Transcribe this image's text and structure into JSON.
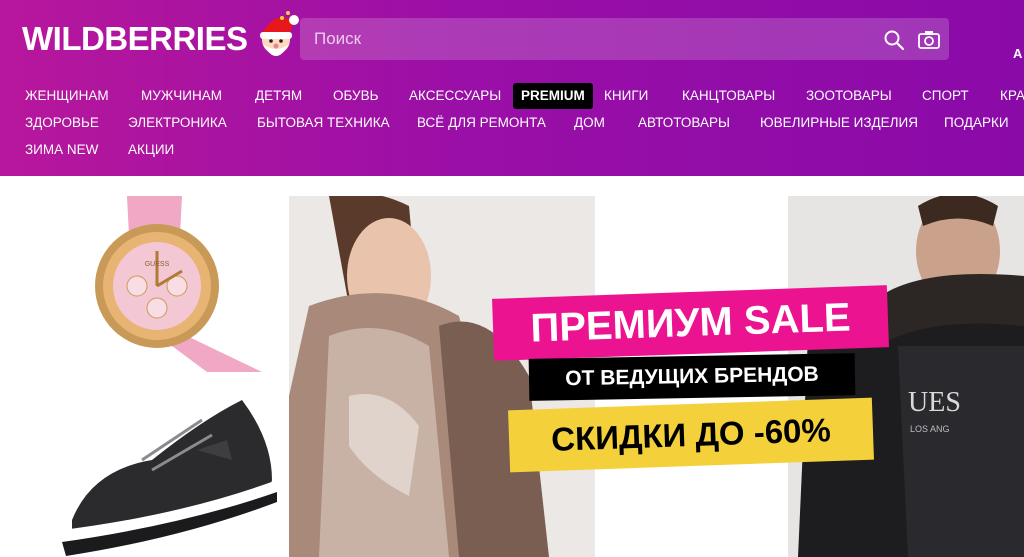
{
  "header": {
    "logo_text": "WILDBERRIES",
    "search": {
      "placeholder": "Поиск"
    },
    "right_edge_text": "А",
    "brand_color": "#a312a6"
  },
  "nav": {
    "row1": [
      {
        "label": "ЖЕНЩИНАМ"
      },
      {
        "label": "МУЖЧИНАМ"
      },
      {
        "label": "ДЕТЯМ"
      },
      {
        "label": "ОБУВЬ"
      },
      {
        "label": "АКСЕССУАРЫ"
      },
      {
        "label": "PREMIUM"
      },
      {
        "label": "КНИГИ"
      },
      {
        "label": "КАНЦТОВАРЫ"
      },
      {
        "label": "ЗООТОВАРЫ"
      },
      {
        "label": "СПОРТ"
      },
      {
        "label": "КРА"
      }
    ],
    "row2": [
      {
        "label": "ЗДОРОВЬЕ"
      },
      {
        "label": "ЭЛЕКТРОНИКА"
      },
      {
        "label": "БЫТОВАЯ ТЕХНИКА"
      },
      {
        "label": "ВСЁ ДЛЯ РЕМОНТА"
      },
      {
        "label": "ДОМ"
      },
      {
        "label": "АВТОТОВАРЫ"
      },
      {
        "label": "ЮВЕЛИРНЫЕ ИЗДЕЛИЯ"
      },
      {
        "label": "ПОДАРКИ"
      }
    ],
    "row3": [
      {
        "label": "ЗИМА NEW"
      },
      {
        "label": "АКЦИИ"
      }
    ]
  },
  "banner": {
    "title": "ПРЕМИУМ SALE",
    "subtitle": "ОТ ВЕДУЩИХ БРЕНДОВ",
    "discount": "СКИДКИ ДО -60%",
    "title_color": "#ec1390",
    "discount_color": "#f4d13b"
  },
  "products": {
    "watch": {
      "brand_mark": "GUESS"
    },
    "man_shirt": {
      "print": "UES",
      "print_sub": "LOS ANG"
    }
  },
  "icons": [
    "search-icon",
    "camera-icon",
    "santa-icon"
  ]
}
